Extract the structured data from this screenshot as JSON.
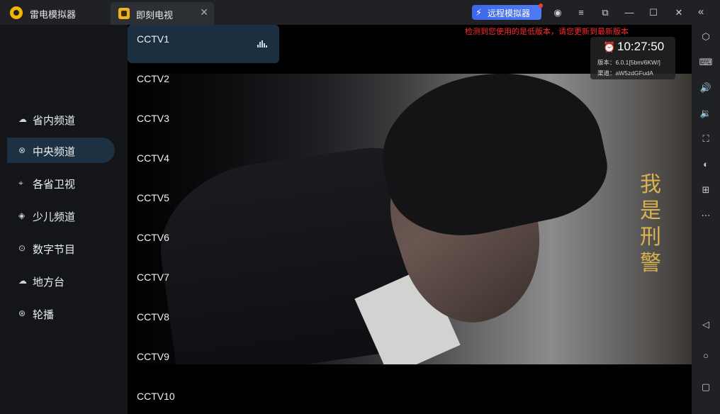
{
  "titlebar": {
    "app_title": "雷电模拟器",
    "tab_title": "即刻电视",
    "tab_close": "✕",
    "remote_label": "远程模拟器",
    "remote_icon": "⚡",
    "controls": {
      "account": "◉",
      "menu": "≡",
      "restore": "⧉",
      "minimize": "—",
      "maximize": "☐",
      "close": "✕",
      "collapse": "«"
    }
  },
  "categories": [
    {
      "label": "省内频道",
      "icon": "☁",
      "active": false
    },
    {
      "label": "中央频道",
      "icon": "⊗",
      "active": true
    },
    {
      "label": "各省卫视",
      "icon": "⌖",
      "active": false
    },
    {
      "label": "少儿频道",
      "icon": "◈",
      "active": false
    },
    {
      "label": "数字节目",
      "icon": "⊙",
      "active": false
    },
    {
      "label": "地方台",
      "icon": "☁",
      "active": false
    },
    {
      "label": "轮播",
      "icon": "⊛",
      "active": false
    }
  ],
  "channels": [
    "CCTV1",
    "CCTV2",
    "CCTV3",
    "CCTV4",
    "CCTV5",
    "CCTV6",
    "CCTV7",
    "CCTV8",
    "CCTV9",
    "CCTV10"
  ],
  "player": {
    "notice": "检测到您使用的是低版本，请您更新到最新版本",
    "clock": "10:27:50",
    "version": "版本：6.0.1[5bm/6KW/]",
    "channel_source": "渠道：aW5zdGFudA",
    "watermark": [
      "我",
      "是",
      "刑",
      "警"
    ]
  },
  "right_toolbar": [
    "⬡",
    "⌨",
    "🔊",
    "🔉",
    "⛶",
    "◐",
    "⊞",
    "⋯",
    "◁",
    "○",
    "▢"
  ]
}
